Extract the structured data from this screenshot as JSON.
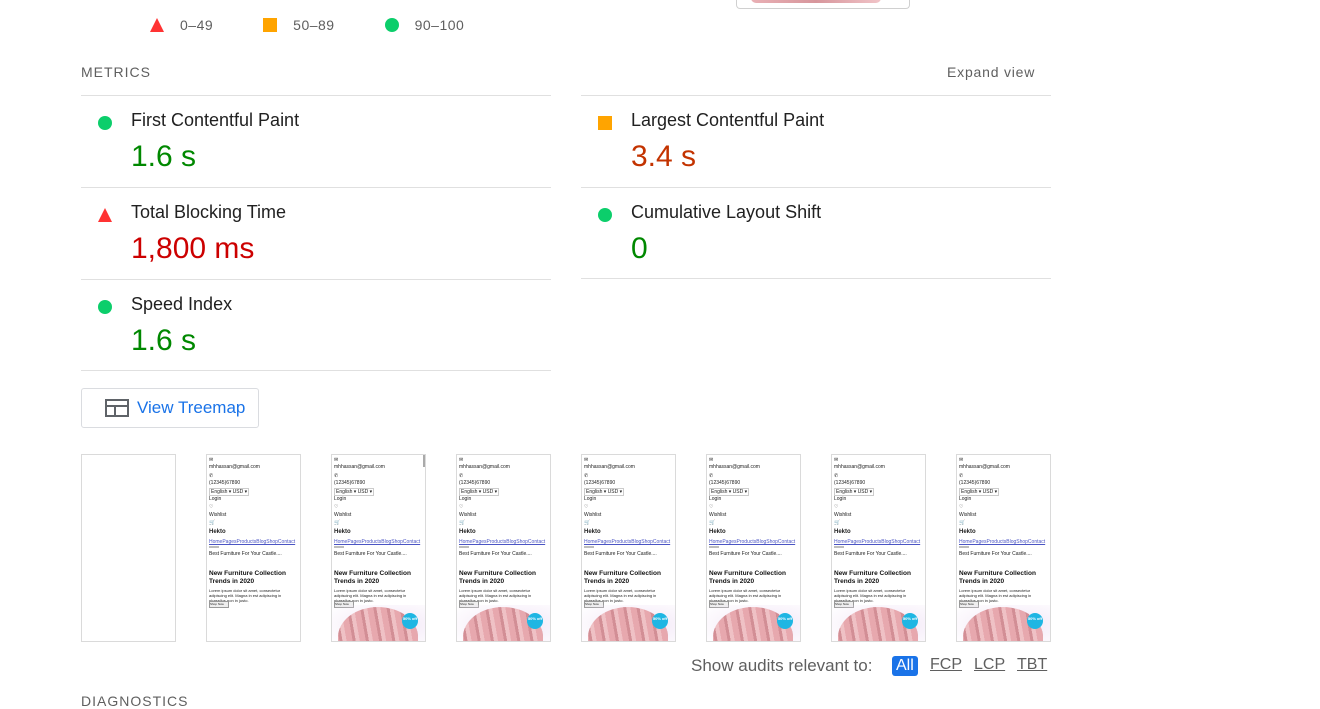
{
  "legend": [
    {
      "shape": "triangle",
      "color": "#ff3333",
      "label": "0–49"
    },
    {
      "shape": "square",
      "color": "#ffa400",
      "label": "50–89"
    },
    {
      "shape": "circle",
      "color": "#0cce6b",
      "label": "90–100"
    }
  ],
  "metrics_section": {
    "title": "METRICS",
    "expand_label": "Expand view",
    "items": [
      {
        "name": "First Contentful Paint",
        "value": "1.6 s",
        "rating": "good"
      },
      {
        "name": "Largest Contentful Paint",
        "value": "3.4 s",
        "rating": "average"
      },
      {
        "name": "Total Blocking Time",
        "value": "1,800 ms",
        "rating": "poor"
      },
      {
        "name": "Cumulative Layout Shift",
        "value": "0",
        "rating": "good"
      },
      {
        "name": "Speed Index",
        "value": "1.6 s",
        "rating": "good"
      }
    ]
  },
  "treemap": {
    "label": "View Treemap",
    "icon": "treemap-icon"
  },
  "filmstrip": {
    "frame_count": 8,
    "frame_text": {
      "email": "mhhassan@gmail.com",
      "phone": "(12345)67890",
      "language": "English ▾ USD ▾",
      "login": "Login",
      "wishlist": "Wishlist",
      "brand_first": "Hekto",
      "brand": "Hekto",
      "nav": "HomePagesProductsBlogShopContact",
      "tagline": "Best Furniture For Your Castle....",
      "headline": "New Furniture Collection Trends in 2020",
      "body": "Lorem ipsum dolor sit amet, consectetur adipiscing elit. Magna in est adipiscing in phasellus non in justo.",
      "button": "Shop Now",
      "badge": "50% off"
    }
  },
  "audit_filter": {
    "label": "Show audits relevant to:",
    "options": [
      "All",
      "FCP",
      "LCP",
      "TBT"
    ],
    "active": "All"
  },
  "diagnostics": {
    "title": "DIAGNOSTICS"
  },
  "colors": {
    "good": "#008800",
    "average": "#c33300",
    "poor": "#cc0000",
    "link": "#1a73e8"
  }
}
